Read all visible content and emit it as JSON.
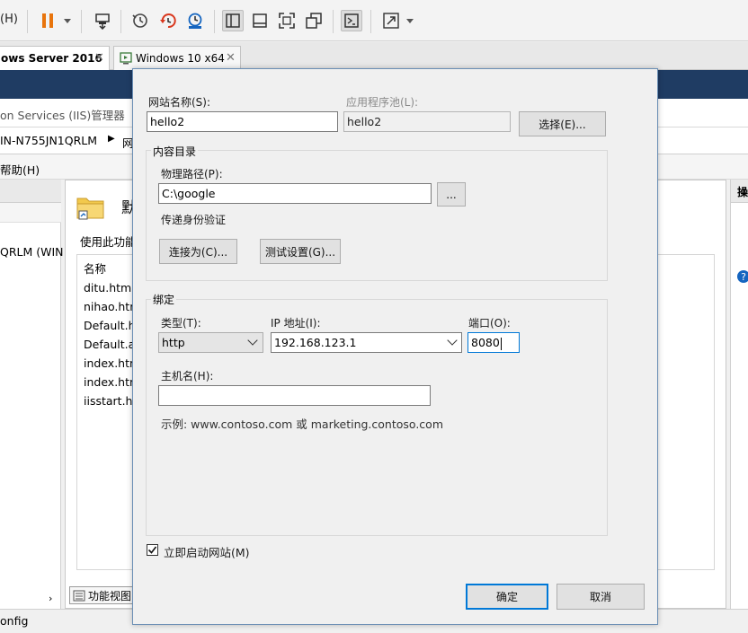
{
  "toolbar": {
    "left_text": "(H)"
  },
  "vm_tabs": [
    {
      "label": "ows Server 2016"
    },
    {
      "label": "Windows 10 x64"
    }
  ],
  "iis": {
    "window_title": "on Services (IIS)管理器",
    "address_host": "IN-N755JN1QRLM",
    "address_next": "网",
    "menu_help": "帮助(H)",
    "left_item": "QRLM (WIN",
    "center_title": "默",
    "center_desc": "使用此功能",
    "list_header": "名称",
    "files": [
      "ditu.html",
      "nihao.htm",
      "Default.ht",
      "Default.as",
      "index.htm",
      "index.htm",
      "iisstart.htr"
    ],
    "view_tab": "功能视图",
    "status_text": "onfig",
    "right_header": "操"
  },
  "dialog": {
    "site_name_label": "网站名称(S):",
    "site_name_value": "hello2",
    "app_pool_label": "应用程序池(L):",
    "app_pool_value": "hello2",
    "select_button": "选择(E)...",
    "content_group": "内容目录",
    "physical_path_label": "物理路径(P):",
    "physical_path_value": "C:\\google",
    "browse_button": "...",
    "pass_through_label": "传递身份验证",
    "connect_as_button": "连接为(C)...",
    "test_settings_button": "测试设置(G)...",
    "binding_group": "绑定",
    "type_label": "类型(T):",
    "type_value": "http",
    "ip_label": "IP 地址(I):",
    "ip_value": "192.168.123.1",
    "port_label": "端口(O):",
    "port_value": "8080",
    "hostname_label": "主机名(H):",
    "hostname_value": "",
    "example_text": "示例: www.contoso.com 或 marketing.contoso.com",
    "start_now_label": "立即启动网站(M)",
    "start_now_checked": true,
    "ok_button": "确定",
    "cancel_button": "取消"
  },
  "colors": {
    "accent": "#0078d7",
    "pause": "#e8740c",
    "history_red": "#d9381e",
    "history_blue": "#1565c0",
    "guest_title": "#1f3c63"
  }
}
